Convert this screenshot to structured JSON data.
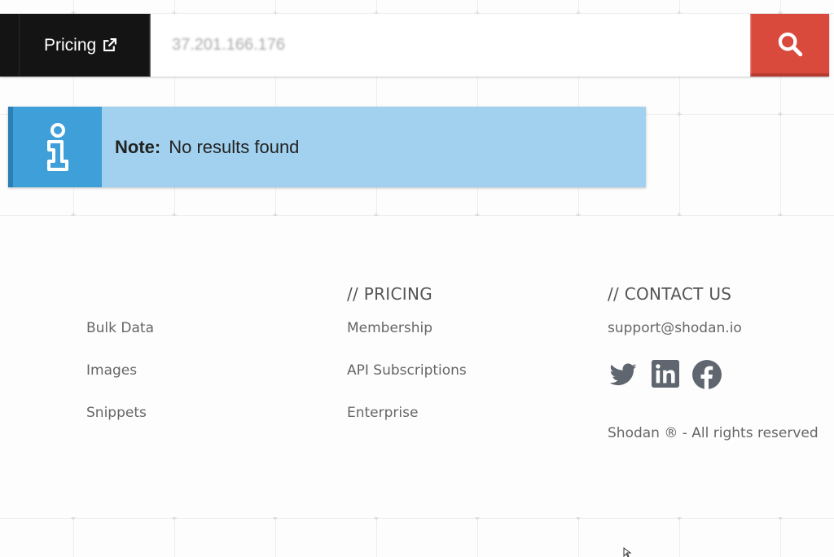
{
  "header": {
    "pricing_label": "Pricing",
    "search_value": "37.201.166.176",
    "search_icon": "search-icon",
    "accent": "#d9493c"
  },
  "alert": {
    "label": "Note:",
    "message": "No results found",
    "color": "#a1d1ee"
  },
  "footer": {
    "col1": {
      "title": "",
      "links": [
        "Bulk Data",
        "Images",
        "Snippets"
      ]
    },
    "col2": {
      "title": "// PRICING",
      "links": [
        "Membership",
        "API Subscriptions",
        "Enterprise"
      ]
    },
    "col3": {
      "title": "// CONTACT US",
      "email": "support@shodan.io",
      "social": [
        "twitter-icon",
        "linkedin-icon",
        "facebook-icon"
      ],
      "copyright": "Shodan ® - All rights reserved"
    }
  }
}
